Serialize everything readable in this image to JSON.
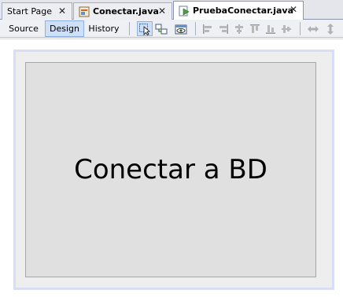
{
  "tabs": [
    {
      "label": "Start Page",
      "active": false,
      "bold": false,
      "icon": null
    },
    {
      "label": "Conectar.java",
      "active": false,
      "bold": true,
      "icon": "form-file-icon"
    },
    {
      "label": "PruebaConectar.java",
      "active": true,
      "bold": true,
      "icon": "form-run-file-icon"
    }
  ],
  "close_glyph": "✕",
  "view_buttons": {
    "source": "Source",
    "design": "Design",
    "history": "History",
    "selected": "Design"
  },
  "toolbar_icons": [
    "selection-mode-icon",
    "connection-mode-icon",
    "preview-design-icon",
    "align-left-icon",
    "align-right-icon",
    "center-horizontally-icon",
    "align-top-icon",
    "align-bottom-icon",
    "center-vertically-icon",
    "resize-horizontally-icon",
    "resize-vertically-icon"
  ],
  "design": {
    "label_text": "Conectar a BD"
  },
  "colors": {
    "selected_button": "#cde0f7",
    "form_border": "#d9ddf7",
    "form_background": "#e0e0e0"
  }
}
